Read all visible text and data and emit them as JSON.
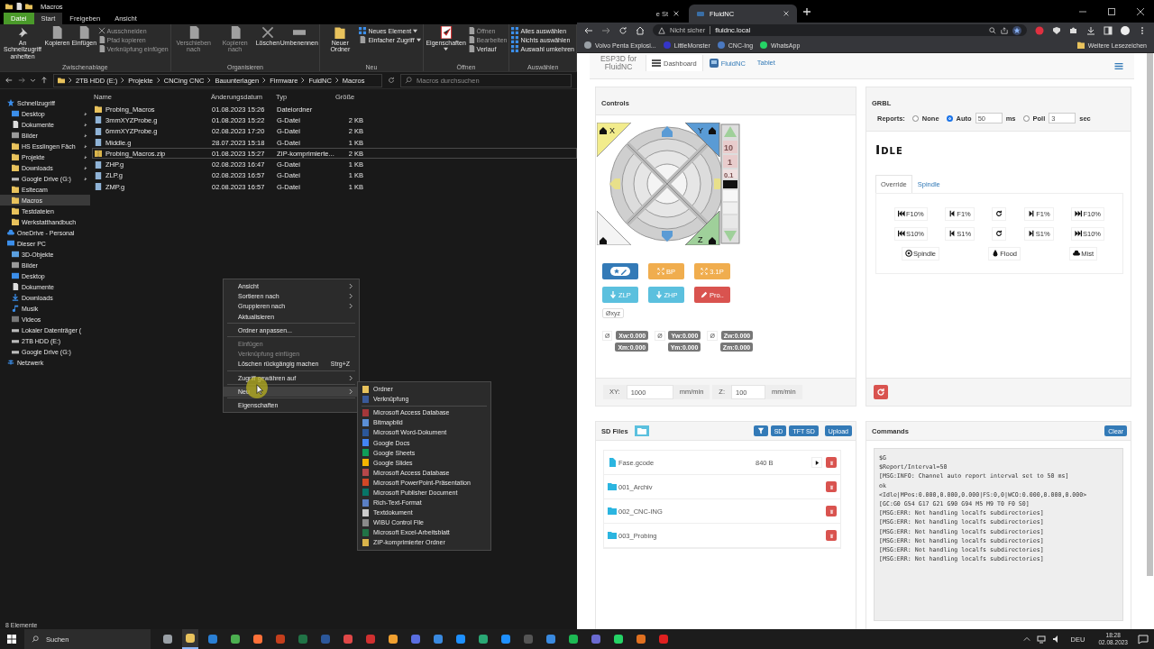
{
  "explorer": {
    "title": "Macros",
    "ribbon_tabs": [
      {
        "label": "Datei",
        "kind": "file",
        "selected": false
      },
      {
        "label": "Start",
        "kind": "tab",
        "selected": true
      },
      {
        "label": "Freigeben",
        "kind": "tab",
        "selected": false
      },
      {
        "label": "Ansicht",
        "kind": "tab",
        "selected": false
      }
    ],
    "ribbon_groups": [
      {
        "label": "Zwischenablage",
        "items": [
          {
            "label": "An Schnellzugriff anheften",
            "kind": "large",
            "disabled": false,
            "dropdown": false
          },
          {
            "label": "Kopieren",
            "kind": "large",
            "disabled": false,
            "dropdown": false
          },
          {
            "label": "Einfügen",
            "kind": "large",
            "disabled": false,
            "dropdown": false
          },
          {
            "label": "Ausschneiden",
            "kind": "small",
            "disabled": true,
            "dropdown": false
          },
          {
            "label": "Pfad kopieren",
            "kind": "small",
            "disabled": true,
            "dropdown": false
          },
          {
            "label": "Verknüpfung einfügen",
            "kind": "small",
            "disabled": true,
            "dropdown": false
          }
        ]
      },
      {
        "label": "Organisieren",
        "items": [
          {
            "label": "Verschieben nach",
            "kind": "large",
            "disabled": true,
            "dropdown": false
          },
          {
            "label": "Kopieren nach",
            "kind": "large",
            "disabled": true,
            "dropdown": false
          },
          {
            "label": "Löschen",
            "kind": "large",
            "disabled": false,
            "dropdown": false
          },
          {
            "label": "Umbenennen",
            "kind": "large",
            "disabled": false,
            "dropdown": false
          }
        ]
      },
      {
        "label": "Neu",
        "items": [
          {
            "label": "Neuer Ordner",
            "kind": "large",
            "disabled": false,
            "dropdown": false
          },
          {
            "label": "Neues Element",
            "kind": "small",
            "disabled": false,
            "dropdown": true
          },
          {
            "label": "Einfacher Zugriff",
            "kind": "small",
            "disabled": false,
            "dropdown": true
          }
        ]
      },
      {
        "label": "Öffnen",
        "items": [
          {
            "label": "Eigenschaften",
            "kind": "large",
            "disabled": false,
            "dropdown": true
          },
          {
            "label": "Öffnen",
            "kind": "small",
            "disabled": true,
            "dropdown": false
          },
          {
            "label": "Bearbeiten",
            "kind": "small",
            "disabled": true,
            "dropdown": false
          },
          {
            "label": "Verlauf",
            "kind": "small",
            "disabled": false,
            "dropdown": false
          }
        ]
      },
      {
        "label": "Auswählen",
        "items": [
          {
            "label": "Alles auswählen",
            "kind": "small",
            "disabled": false,
            "dropdown": false
          },
          {
            "label": "Nichts auswählen",
            "kind": "small",
            "disabled": false,
            "dropdown": false
          },
          {
            "label": "Auswahl umkehren",
            "kind": "small",
            "disabled": false,
            "dropdown": false
          }
        ]
      }
    ],
    "path": [
      "2TB HDD (E:)",
      "Projekte",
      "CNCing CNC",
      "Bauunterlagen",
      "Firmware",
      "FuidNC",
      "Macros"
    ],
    "search": {
      "placeholder": "Macros durchsuchen"
    },
    "nav": [
      {
        "label": "Schnellzugriff",
        "kind": "star",
        "selected": false,
        "children": [
          {
            "label": "Desktop",
            "kind": "desktop",
            "pinned": true,
            "selected": false
          },
          {
            "label": "Dokumente",
            "kind": "doc",
            "pinned": true,
            "selected": false
          },
          {
            "label": "Bilder",
            "kind": "pictures",
            "pinned": true,
            "selected": false
          },
          {
            "label": "HS Esslingen Fäch",
            "kind": "folder",
            "pinned": true,
            "selected": false
          },
          {
            "label": "Projekte",
            "kind": "folder",
            "pinned": true,
            "selected": false
          },
          {
            "label": "Downloads",
            "kind": "folder",
            "pinned": true,
            "selected": false
          },
          {
            "label": "Google Drive (G:)",
            "kind": "drive",
            "pinned": true,
            "selected": false
          },
          {
            "label": "Esltecam",
            "kind": "folder",
            "pinned": false,
            "selected": false
          },
          {
            "label": "Macros",
            "kind": "folder",
            "pinned": false,
            "selected": true
          },
          {
            "label": "Testdateien",
            "kind": "folder",
            "pinned": false,
            "selected": false
          },
          {
            "label": "Werkstatthandbuch",
            "kind": "folder",
            "pinned": false,
            "selected": false
          }
        ]
      },
      {
        "label": "OneDrive - Personal",
        "kind": "cloud",
        "selected": false
      },
      {
        "label": "Dieser PC",
        "kind": "pc",
        "selected": false,
        "children": [
          {
            "label": "3D-Objekte",
            "kind": "cube",
            "pinned": false,
            "selected": false
          },
          {
            "label": "Bilder",
            "kind": "pictures",
            "pinned": false,
            "selected": false
          },
          {
            "label": "Desktop",
            "kind": "desktop",
            "pinned": false,
            "selected": false
          },
          {
            "label": "Dokumente",
            "kind": "doc",
            "pinned": false,
            "selected": false
          },
          {
            "label": "Downloads",
            "kind": "download",
            "pinned": false,
            "selected": false
          },
          {
            "label": "Musik",
            "kind": "music",
            "pinned": false,
            "selected": false
          },
          {
            "label": "Videos",
            "kind": "video",
            "pinned": false,
            "selected": false
          },
          {
            "label": "Lokaler Datenträger (",
            "kind": "drive",
            "pinned": false,
            "selected": false
          },
          {
            "label": "2TB HDD  (E:)",
            "kind": "drive",
            "pinned": false,
            "selected": false
          },
          {
            "label": "Google Drive (G:)",
            "kind": "drive",
            "pinned": false,
            "selected": false
          }
        ]
      },
      {
        "label": "Netzwerk",
        "kind": "network",
        "selected": false
      }
    ],
    "columns": [
      "Name",
      "Änderungsdatum",
      "Typ",
      "Größe"
    ],
    "files": [
      {
        "name": "Probing_Macros",
        "date": "01.08.2023 15:26",
        "type": "Dateiordner",
        "kind": "folder",
        "selected": false
      },
      {
        "name": "3mmXYZProbe.g",
        "date": "01.08.2023 15:22",
        "type": "G-Datei",
        "size": "2 KB",
        "kind": "file",
        "selected": false
      },
      {
        "name": "6mmXYZProbe.g",
        "date": "02.08.2023 17:20",
        "type": "G-Datei",
        "size": "2 KB",
        "kind": "file",
        "selected": false
      },
      {
        "name": "Middle.g",
        "date": "28.07.2023 15:18",
        "type": "G-Datei",
        "size": "1 KB",
        "kind": "file",
        "selected": false
      },
      {
        "name": "Probing_Macros.zip",
        "date": "01.08.2023 15:27",
        "type": "ZIP-komprimierte...",
        "size": "2 KB",
        "kind": "zip",
        "selected": true
      },
      {
        "name": "ZHP.g",
        "date": "02.08.2023 16:47",
        "type": "G-Datei",
        "size": "1 KB",
        "kind": "file",
        "selected": false
      },
      {
        "name": "ZLP.g",
        "date": "02.08.2023 16:57",
        "type": "G-Datei",
        "size": "1 KB",
        "kind": "file",
        "selected": false
      },
      {
        "name": "ZMP.g",
        "date": "02.08.2023 16:57",
        "type": "G-Datei",
        "size": "1 KB",
        "kind": "file",
        "selected": false
      }
    ],
    "status": "8 Elemente",
    "context_menu": [
      {
        "kind": "item",
        "label": "Ansicht",
        "submenu": true,
        "disabled": false,
        "selected": false
      },
      {
        "kind": "item",
        "label": "Sortieren nach",
        "submenu": true,
        "disabled": false,
        "selected": false
      },
      {
        "kind": "item",
        "label": "Gruppieren nach",
        "submenu": true,
        "disabled": false,
        "selected": false
      },
      {
        "kind": "item",
        "label": "Aktualisieren",
        "submenu": false,
        "disabled": false,
        "selected": false
      },
      {
        "kind": "separator"
      },
      {
        "kind": "item",
        "label": "Ordner anpassen...",
        "submenu": false,
        "disabled": false,
        "selected": false
      },
      {
        "kind": "separator"
      },
      {
        "kind": "item",
        "label": "Einfügen",
        "submenu": false,
        "disabled": true,
        "selected": false
      },
      {
        "kind": "item",
        "label": "Verknüpfung einfügen",
        "submenu": false,
        "disabled": true,
        "selected": false
      },
      {
        "kind": "item",
        "label": "Löschen rückgängig machen",
        "shortcut": "Strg+Z",
        "submenu": false,
        "disabled": false,
        "selected": false
      },
      {
        "kind": "separator"
      },
      {
        "kind": "item",
        "label": "Zugriff gewähren auf",
        "submenu": true,
        "disabled": false,
        "selected": false
      },
      {
        "kind": "separator"
      },
      {
        "kind": "item",
        "label": "Neu",
        "submenu": true,
        "disabled": false,
        "selected": true
      },
      {
        "kind": "separator"
      },
      {
        "kind": "item",
        "label": "Eigenschaften",
        "submenu": false,
        "disabled": false,
        "selected": false
      }
    ],
    "new_submenu": [
      {
        "kind": "item",
        "label": "Ordner",
        "color": "#e8c25c"
      },
      {
        "kind": "item",
        "label": "Verknüpfung",
        "color": "#3a5a9a"
      },
      {
        "kind": "separator"
      },
      {
        "kind": "item",
        "label": "Microsoft Access Database",
        "color": "#a4373a"
      },
      {
        "kind": "item",
        "label": "Bitmapbild",
        "color": "#5b8fd6"
      },
      {
        "kind": "item",
        "label": "Microsoft Word-Dokument",
        "color": "#2b579a"
      },
      {
        "kind": "item",
        "label": "Google Docs",
        "color": "#4285f4"
      },
      {
        "kind": "item",
        "label": "Google Sheets",
        "color": "#0f9d58"
      },
      {
        "kind": "item",
        "label": "Google Slides",
        "color": "#f4b400"
      },
      {
        "kind": "item",
        "label": "Microsoft Access Database",
        "color": "#b5474a"
      },
      {
        "kind": "item",
        "label": "Microsoft PowerPoint-Präsentation",
        "color": "#d24726"
      },
      {
        "kind": "item",
        "label": "Microsoft Publisher Document",
        "color": "#077568"
      },
      {
        "kind": "item",
        "label": "Rich-Text-Format",
        "color": "#5a7fc4"
      },
      {
        "kind": "item",
        "label": "Textdokument",
        "color": "#cccccc"
      },
      {
        "kind": "item",
        "label": "WIBU Control File",
        "color": "#8a8a8a"
      },
      {
        "kind": "item",
        "label": "Microsoft Excel-Arbeitsblatt",
        "color": "#217346"
      },
      {
        "kind": "item",
        "label": "ZIP-komprimierter Ordner",
        "color": "#d9b44a"
      }
    ]
  },
  "browser": {
    "tabs": [
      {
        "label": "e St",
        "selected": false
      },
      {
        "label": "FluidNC",
        "selected": true
      }
    ],
    "security": "Nicht sicher",
    "url": "fluidnc.local",
    "bookmarks": [
      {
        "label": "Volvo Penta Explosi...",
        "color": "#9aa0a6"
      },
      {
        "label": "LittleMonster",
        "color": "#3535c8"
      },
      {
        "label": "CNC-Ing",
        "color": "#4a78c0"
      },
      {
        "label": "WhatsApp",
        "color": "#25d366"
      }
    ],
    "other_bookmarks": "Weitere Lesezeichen"
  },
  "app": {
    "brand": "ESP3D for FluidNC",
    "nav": [
      {
        "label": "Dashboard",
        "kind": "list",
        "selected": true
      },
      {
        "label": "FluidNC",
        "kind": "logo",
        "selected": false
      },
      {
        "label": "Tablet",
        "kind": "text",
        "selected": false
      }
    ],
    "controls": {
      "title": "Controls",
      "jog": {
        "corners": [
          "X",
          "Y",
          "Z"
        ],
        "steps": [
          "10",
          "1",
          "0.1"
        ]
      },
      "macros": [
        {
          "kind": "star-pencil",
          "color": "#337ab7"
        },
        {
          "label": "BP",
          "kind": "expand",
          "color": "#f0ad4e"
        },
        {
          "label": "3.1P",
          "kind": "expand",
          "color": "#f0ad4e"
        },
        {
          "label": "ZLP",
          "kind": "down",
          "color": "#5bc0de"
        },
        {
          "label": "ZHP",
          "kind": "down",
          "color": "#5bc0de"
        },
        {
          "label": "Pro..",
          "kind": "pencil",
          "color": "#d9534f"
        }
      ],
      "zero_all": "Øxyz",
      "positions": [
        {
          "zero": "Ø",
          "work": "Xw:0.000",
          "machine": "Xm:0.000"
        },
        {
          "zero": "Ø",
          "work": "Yw:0.000",
          "machine": "Ym:0.000"
        },
        {
          "zero": "Ø",
          "work": "Zw:0.000",
          "machine": "Zm:0.000"
        }
      ],
      "feed": [
        {
          "label": "XY:",
          "value": "1000",
          "unit": "mm/min"
        },
        {
          "label": "Z:",
          "value": "100",
          "unit": "mm/min"
        }
      ]
    },
    "grbl": {
      "title": "GRBL",
      "reports_label": "Reports:",
      "report_modes": [
        {
          "label": "None",
          "selected": false
        },
        {
          "label": "Auto",
          "selected": true,
          "value": "50",
          "unit": "ms"
        },
        {
          "label": "Poll",
          "selected": false,
          "value": "3",
          "unit": "sec"
        }
      ],
      "state": "Idle",
      "tabs": [
        {
          "label": "Override",
          "selected": true
        },
        {
          "label": "Spindle",
          "selected": false
        }
      ],
      "overrides": [
        [
          {
            "label": "F10%",
            "kind": "fast-back"
          },
          {
            "label": "F1%",
            "kind": "back"
          },
          {
            "kind": "reset"
          },
          {
            "label": "F1%",
            "kind": "fwd"
          },
          {
            "label": "F10%",
            "kind": "fast-fwd"
          }
        ],
        [
          {
            "label": "S10%",
            "kind": "fast-back"
          },
          {
            "label": "S1%",
            "kind": "back"
          },
          {
            "kind": "reset"
          },
          {
            "label": "S1%",
            "kind": "fwd"
          },
          {
            "label": "S10%",
            "kind": "fast-fwd"
          }
        ],
        [
          {
            "label": "Spindle",
            "kind": "target"
          },
          {
            "label": "Flood",
            "kind": "drop"
          },
          {
            "label": "Mist",
            "kind": "cloud"
          }
        ]
      ]
    },
    "sd": {
      "title": "SD Files",
      "sources": [
        "SD",
        "TFT SD"
      ],
      "upload": "Upload",
      "files": [
        {
          "name": "Fase.gcode",
          "size": "840 B",
          "kind": "file"
        },
        {
          "name": "001_Archiv",
          "kind": "folder"
        },
        {
          "name": "002_CNC-ING",
          "kind": "folder"
        },
        {
          "name": "003_Probing",
          "kind": "folder"
        }
      ]
    },
    "commands": {
      "title": "Commands",
      "clear": "Clear",
      "log": [
        "$G",
        "$Report/Interval=50",
        "[MSG:INFO: Channel auto report interval set to 50 ms]",
        "ok",
        "<Idle|MPos:0.000,0.000,0.000|FS:0,0|WCO:0.000,0.000,0.000>",
        "[GC:G0 G54 G17 G21 G90 G94 M5 M9 T0 F0 S0]",
        "[MSG:ERR: Not handling localfs subdirectories]",
        "[MSG:ERR: Not handling localfs subdirectories]",
        "[MSG:ERR: Not handling localfs subdirectories]",
        "[MSG:ERR: Not handling localfs subdirectories]",
        "[MSG:ERR: Not handling localfs subdirectories]",
        "[MSG:ERR: Not handling localfs subdirectories]"
      ]
    }
  },
  "taskbar": {
    "search": "Suchen",
    "apps": [
      {
        "color": "#9aa0a6",
        "selected": false
      },
      {
        "color": "#e8c25c",
        "selected": true
      },
      {
        "color": "#2a7fd4",
        "selected": false
      },
      {
        "color": "#4caf50",
        "selected": false
      },
      {
        "color": "#ff7139",
        "selected": false
      },
      {
        "color": "#c43e1c",
        "selected": false
      },
      {
        "color": "#217346",
        "selected": false
      },
      {
        "color": "#2b579a",
        "selected": false
      },
      {
        "color": "#e04848",
        "selected": false
      },
      {
        "color": "#d03030",
        "selected": false
      },
      {
        "color": "#f0a030",
        "selected": false
      },
      {
        "color": "#5a6ee0",
        "selected": false
      },
      {
        "color": "#3a8ae0",
        "selected": false
      },
      {
        "color": "#1e90ff",
        "selected": false
      },
      {
        "color": "#2aa875",
        "selected": false
      },
      {
        "color": "#1e90ff",
        "selected": false
      },
      {
        "color": "#555555",
        "selected": false
      },
      {
        "color": "#3a8ae0",
        "selected": false
      },
      {
        "color": "#1db954",
        "selected": false
      },
      {
        "color": "#6a6ad0",
        "selected": false
      },
      {
        "color": "#25d366",
        "selected": false
      },
      {
        "color": "#e07020",
        "selected": false
      },
      {
        "color": "#e02020",
        "selected": false
      }
    ],
    "language": "DEU",
    "time": "18:28",
    "date": "02.08.2023"
  }
}
